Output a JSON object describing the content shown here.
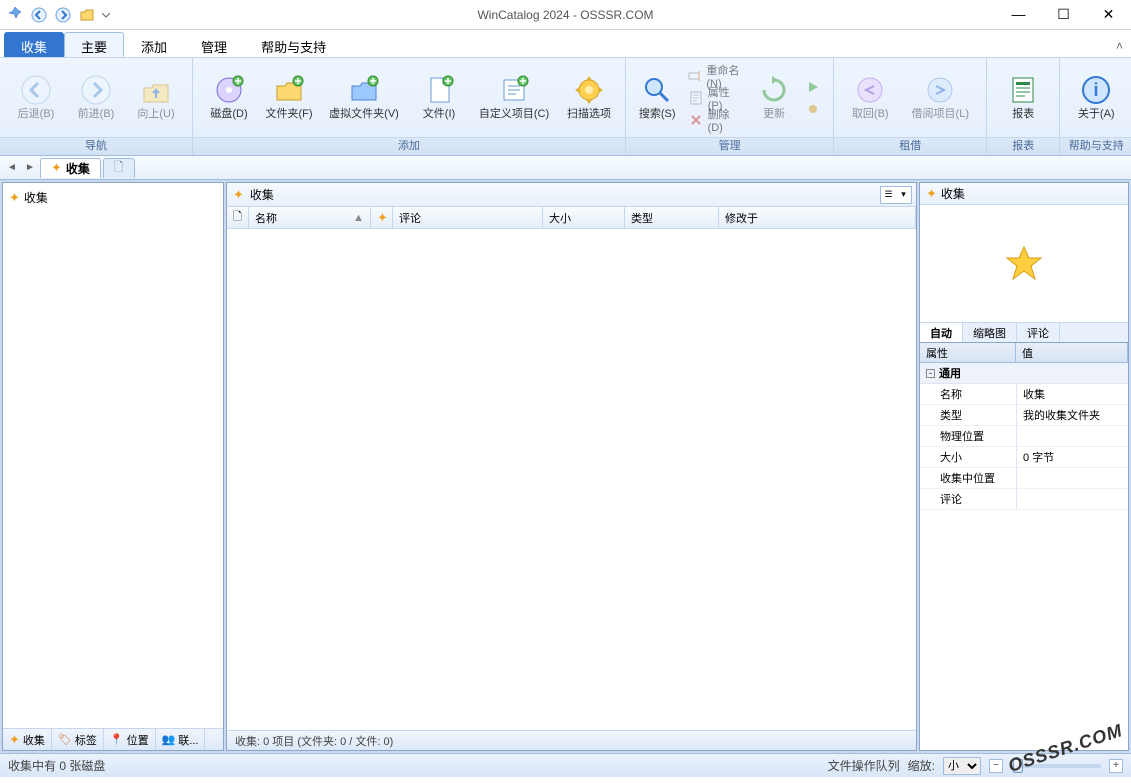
{
  "title": "WinCatalog 2024 - OSSSR.COM",
  "watermark": "OSSSR.COM",
  "ribbonTabs": {
    "file": "收集",
    "main": "主要",
    "add": "添加",
    "manage": "管理",
    "help": "帮助与支持"
  },
  "ribbon": {
    "nav": {
      "back": "后退(B)",
      "forward": "前进(B)",
      "up": "向上(U)",
      "group": "导航"
    },
    "add": {
      "disk": "磁盘(D)",
      "folder": "文件夹(F)",
      "virtual": "虚拟文件夹(V)",
      "files": "文件(I)",
      "custom": "自定义项目(C)",
      "scan": "扫描选项",
      "group": "添加"
    },
    "manage": {
      "search": "搜索(S)",
      "rename": "重命名(N)",
      "props": "属性(P)",
      "delete": "删除(D)",
      "update": "更新",
      "group": "管理"
    },
    "loan": {
      "return": "取回(B)",
      "loan": "借阅项目(L)",
      "group": "租借"
    },
    "report": {
      "report": "报表",
      "group": "报表"
    },
    "helpg": {
      "about": "关于(A)",
      "group": "帮助与支持"
    }
  },
  "wsTabs": {
    "collection": "收集"
  },
  "tree": {
    "root": "收集"
  },
  "leftTabs": {
    "collection": "收集",
    "tags": "标签",
    "location": "位置",
    "contacts": "联..."
  },
  "center": {
    "header": "收集",
    "cols": {
      "icon": "",
      "name": "名称",
      "rating": "",
      "comment": "评论",
      "size": "大小",
      "type": "类型",
      "modified": "修改于"
    },
    "status": "收集: 0 项目 (文件夹: 0 / 文件: 0)"
  },
  "right": {
    "header": "收集",
    "tabs": {
      "auto": "自动",
      "thumb": "缩略图",
      "comment": "评论"
    },
    "propsHdr": {
      "attr": "属性",
      "val": "值"
    },
    "group": "通用",
    "props": {
      "name_k": "名称",
      "name_v": "收集",
      "type_k": "类型",
      "type_v": "我的收集文件夹",
      "loc_k": "物理位置",
      "loc_v": "",
      "size_k": "大小",
      "size_v": "0 字节",
      "colpos_k": "收集中位置",
      "colpos_v": "",
      "comment_k": "评论",
      "comment_v": ""
    }
  },
  "status": {
    "left": "收集中有 0 张磁盘",
    "queue": "文件操作队列",
    "zoomLabel": "缩放:",
    "zoomValue": "小"
  }
}
